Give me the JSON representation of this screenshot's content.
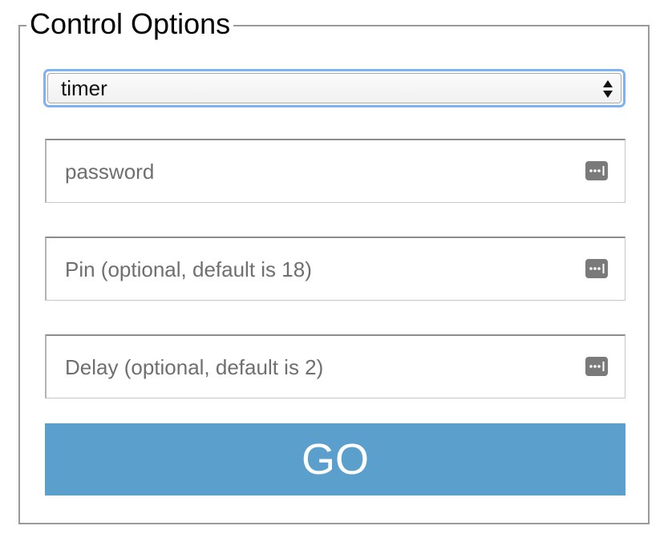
{
  "form": {
    "legend": "Control Options",
    "mode_select": {
      "value": "timer"
    },
    "password_field": {
      "placeholder": "password",
      "icon": "password-key-icon"
    },
    "pin_field": {
      "placeholder": "Pin (optional, default is 18)",
      "icon": "password-key-icon"
    },
    "delay_field": {
      "placeholder": "Delay (optional, default is 2)",
      "icon": "password-key-icon"
    },
    "submit_label": "GO"
  },
  "colors": {
    "button_bg": "#5b9fcd",
    "button_text": "#ffffff",
    "focus_ring": "#7fb2f0",
    "placeholder": "#6f6f6f",
    "icon": "#7a7a7a"
  }
}
